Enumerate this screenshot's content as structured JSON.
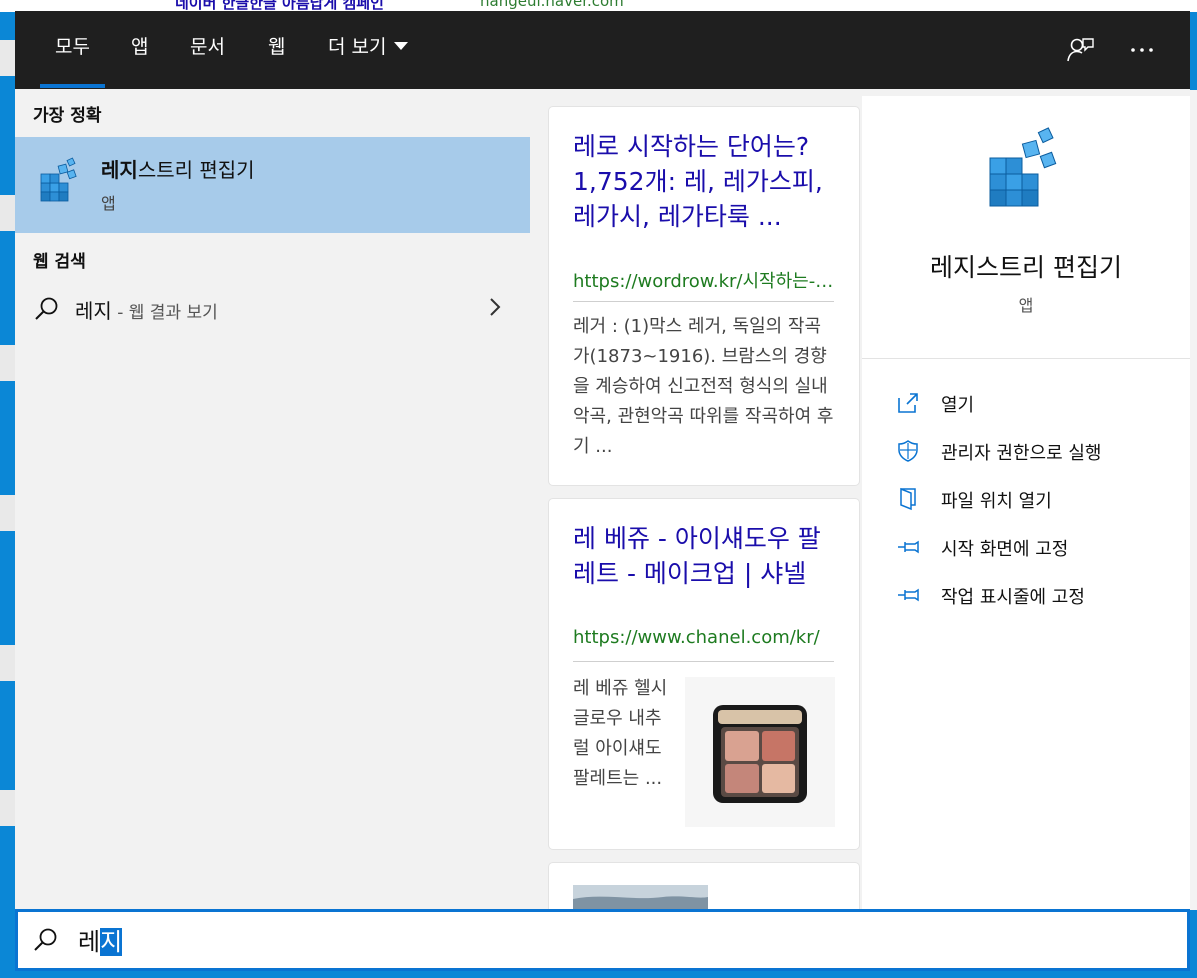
{
  "background": {
    "top_link": "네이버 한글한글 아름답게 캠페인",
    "top_url": "hangeul.naver.com"
  },
  "tabs": [
    {
      "label": "모두",
      "active": true
    },
    {
      "label": "앱",
      "active": false
    },
    {
      "label": "문서",
      "active": false
    },
    {
      "label": "웹",
      "active": false
    },
    {
      "label": "더 보기",
      "active": false
    }
  ],
  "topbar_icons": [
    "feedback-icon",
    "more-options-icon"
  ],
  "best_match": {
    "section_label": "가장 정확",
    "title_bold": "레지",
    "title_rest": "스트리 편집기",
    "subtitle": "앱"
  },
  "web_search": {
    "section_label": "웹 검색",
    "query": "레지",
    "hint": " - 웹 결과 보기"
  },
  "web_results": [
    {
      "title": "레로 시작하는 단어는? 1,752개: 레, 레가스피, 레가시, 레가타룩 ...",
      "url": "https://wordrow.kr/시작하는-말/레/",
      "snippet": "레거 : (1)막스 레거, 독일의 작곡가(1873~1916). 브람스의 경향을 계승하여 신고전적 형식의 실내악곡, 관현악곡 따위를 작곡하여 후기 ..."
    },
    {
      "title": "레 베쥬 - 아이섀도우 팔레트 - 메이크업 | 샤넬",
      "url": "https://www.chanel.com/kr/",
      "snippet": "레 베쥬 헬시 글로우 내추럴 아이섀도 팔레트는 ..."
    }
  ],
  "details": {
    "app_name": "레지스트리 편집기",
    "app_type": "앱",
    "actions": [
      {
        "label": "열기",
        "icon": "open-icon"
      },
      {
        "label": "관리자 권한으로 실행",
        "icon": "shield-icon"
      },
      {
        "label": "파일 위치 열기",
        "icon": "file-location-icon"
      },
      {
        "label": "시작 화면에 고정",
        "icon": "pin-icon"
      },
      {
        "label": "작업 표시줄에 고정",
        "icon": "pin-icon"
      }
    ]
  },
  "search_box": {
    "text_before_selection": "레",
    "selected_text": "지"
  },
  "colors": {
    "accent": "#0a74d2",
    "selected_item": "#a7cbea",
    "topbar": "#1f1f1f",
    "link": "#1a0dab",
    "url": "#1e7b20"
  }
}
